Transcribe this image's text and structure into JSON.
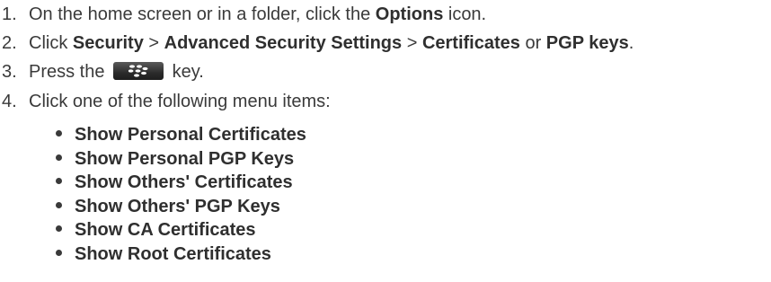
{
  "steps": [
    {
      "number": "1.",
      "parts": [
        "On the home screen or in a folder, click the ",
        "Options",
        " icon."
      ]
    },
    {
      "number": "2.",
      "parts": [
        "Click ",
        "Security",
        " > ",
        "Advanced Security Settings",
        " > ",
        "Certificates",
        " or ",
        "PGP keys",
        "."
      ]
    },
    {
      "number": "3.",
      "parts": [
        "Press the ",
        " key."
      ],
      "key_icon": "blackberry-menu-key-icon"
    },
    {
      "number": "4.",
      "parts": [
        "Click one of the following menu items:"
      ]
    }
  ],
  "menu_items": [
    "Show Personal Certificates",
    "Show Personal PGP Keys",
    "Show Others' Certificates",
    "Show Others' PGP Keys",
    "Show CA Certificates",
    "Show Root Certificates"
  ],
  "colors": {
    "text": "#3a3a3a",
    "key_bg": "#2c2c2c"
  }
}
